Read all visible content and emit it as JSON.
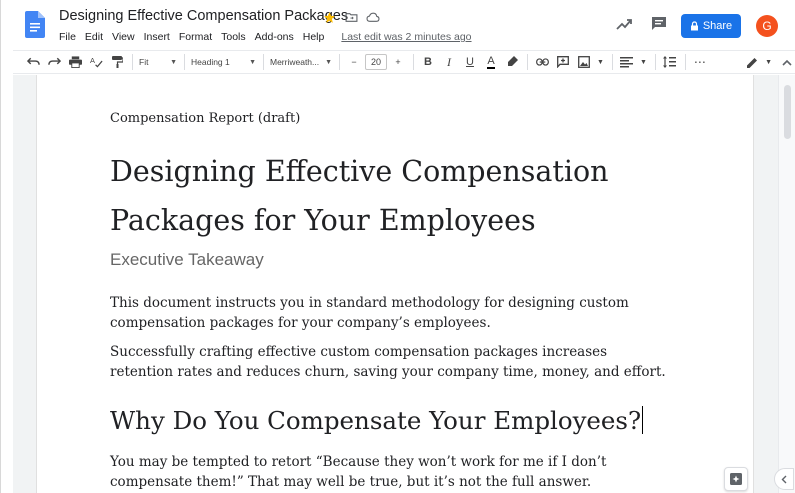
{
  "app": {
    "doc_title": "Designing Effective Compensation Packages",
    "menu": [
      "File",
      "Edit",
      "View",
      "Insert",
      "Format",
      "Tools",
      "Add-ons",
      "Help"
    ],
    "last_edit": "Last edit was 2 minutes ago",
    "share_label": "Share",
    "avatar_initial": "G",
    "colors": {
      "accent": "#1a73e8",
      "avatar": "#f4511e",
      "star": "#fbbc04",
      "doc_icon": "#4285f4"
    }
  },
  "toolbar": {
    "zoom": "Fit",
    "style": "Heading 1",
    "font": "Merriweath...",
    "font_size": "20",
    "icons": [
      "undo-icon",
      "redo-icon",
      "print-icon",
      "spellcheck-icon",
      "paint-format-icon",
      "bold-icon",
      "italic-icon",
      "underline-icon",
      "text-color-icon",
      "highlight-icon",
      "link-icon",
      "add-comment-icon",
      "insert-image-icon",
      "align-icon",
      "line-spacing-icon",
      "more-icon",
      "edit-mode-icon",
      "collapse-icon"
    ],
    "bold": "B",
    "italic": "I",
    "underline": "U",
    "text_color": "A",
    "more": "⋯",
    "minus": "−",
    "plus": "+"
  },
  "document": {
    "subtitle": "Compensation Report (draft)",
    "title": "Designing Effective Compensation Packages for Your Employees",
    "section_label": "Executive Takeaway",
    "paragraph1": "This document instructs you in standard methodology for designing custom compensation packages for your company’s employees.",
    "paragraph2": "Successfully crafting effective custom compensation packages increases retention rates and reduces churn, saving your company time, money, and effort.",
    "heading2": "Why Do You Compensate Your Employees?",
    "paragraph3": "You may be tempted to retort “Because they won’t work for me if I don’t compensate them!” That may well be true, but it’s not the full answer."
  }
}
